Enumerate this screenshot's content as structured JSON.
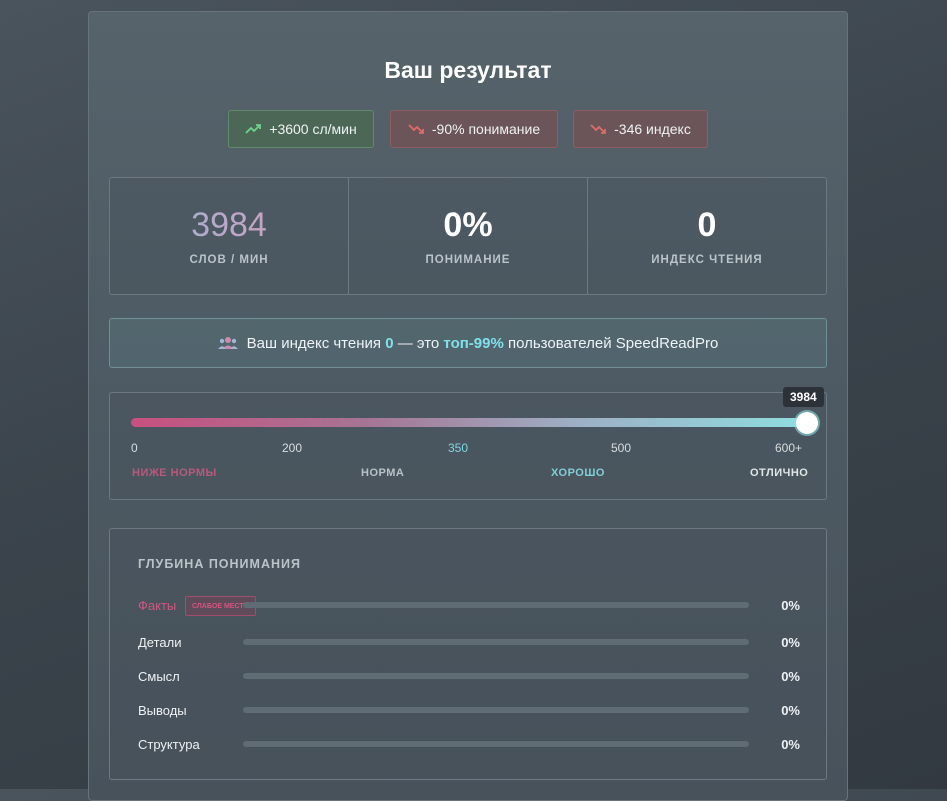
{
  "title": "Ваш результат",
  "chips": [
    {
      "label": "+3600 сл/мин",
      "trend": "up",
      "color": "#6fd38a"
    },
    {
      "label": "-90% понимание",
      "trend": "down",
      "color": "#e06a6a"
    },
    {
      "label": "-346 индекс",
      "trend": "down",
      "color": "#e06a6a"
    }
  ],
  "stats": [
    {
      "value": "3984",
      "label": "СЛОВ / МИН"
    },
    {
      "value": "0%",
      "label": "ПОНИМАНИЕ"
    },
    {
      "value": "0",
      "label": "ИНДЕКС ЧТЕНИЯ"
    }
  ],
  "info": {
    "icon": "users-icon",
    "prefix": "Ваш индекс чтения",
    "index": "0",
    "middle": "— это",
    "rank": "топ-99%",
    "suffix": "пользователей SpeedReadPro"
  },
  "scale": {
    "value": "3984",
    "level": 1.0,
    "ticks": [
      "0",
      "200",
      "350",
      "500",
      "600+"
    ],
    "zones": [
      "НИЖЕ НОРМЫ",
      "НОРМА",
      "ХОРОШО",
      "ОТЛИЧНО"
    ]
  },
  "depth": {
    "title": "ГЛУБИНА ПОНИМАНИЯ",
    "rows": [
      {
        "name": "Факты",
        "badge": "СЛАБОЕ МЕСТО",
        "pct": "0%",
        "level": 0
      },
      {
        "name": "Детали",
        "pct": "0%",
        "level": 0
      },
      {
        "name": "Смысл",
        "pct": "0%",
        "level": 0
      },
      {
        "name": "Выводы",
        "pct": "0%",
        "level": 0
      },
      {
        "name": "Структура",
        "pct": "0%",
        "level": 0
      }
    ]
  }
}
